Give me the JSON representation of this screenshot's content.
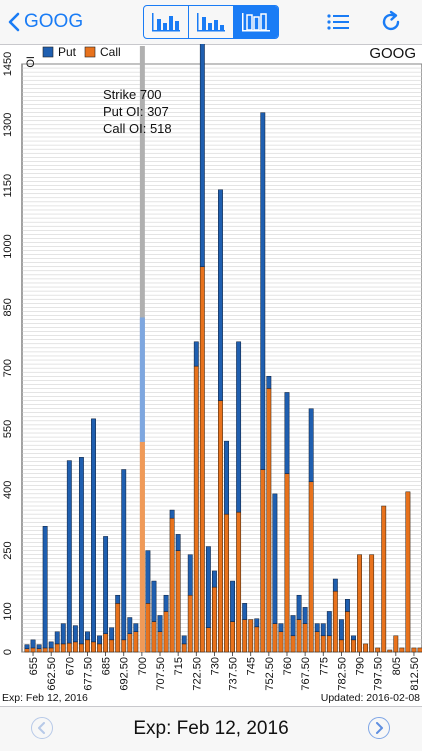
{
  "nav": {
    "back_label": "GOOG",
    "symbol": "GOOG"
  },
  "footer": {
    "exp_small": "Exp: Feb 12, 2016",
    "updated": "Updated: 2016-02-08",
    "exp_title": "Exp: Feb 12, 2016"
  },
  "colors": {
    "accent": "#1a7cf5",
    "put": "#1f5fb0",
    "call": "#e8721c",
    "highlight_put": "#7ea7e0",
    "highlight_call": "#f09a58"
  },
  "icons": {
    "back": "chevron-left-icon",
    "list": "list-icon",
    "refresh": "refresh-icon",
    "prev": "chevron-left-circle-icon",
    "next": "chevron-right-circle-icon"
  },
  "chart_data": {
    "type": "bar",
    "stacked": true,
    "ylabel": "OI",
    "ylim": [
      0,
      1450
    ],
    "yticks": [
      0,
      100,
      250,
      400,
      550,
      700,
      850,
      1000,
      1150,
      1300,
      1450
    ],
    "legend": [
      "Put",
      "Call"
    ],
    "legend_position": "top-left",
    "symbol": "GOOG",
    "highlight": {
      "strike": 700,
      "lines": [
        "Strike 700",
        "Put OI: 307",
        "Call OI: 518"
      ]
    },
    "strikes": [
      652.5,
      655,
      657.5,
      660,
      662.5,
      665,
      667.5,
      670,
      672.5,
      675,
      677.5,
      680,
      682.5,
      685,
      687.5,
      690,
      692.5,
      695,
      697.5,
      700,
      702.5,
      705,
      707.5,
      710,
      712.5,
      715,
      717.5,
      720,
      722.5,
      725,
      727.5,
      730,
      732.5,
      735,
      737.5,
      740,
      742.5,
      745,
      747.5,
      750,
      752.5,
      755,
      757.5,
      760,
      762.5,
      765,
      767.5,
      770,
      772.5,
      775,
      777.5,
      780,
      782.5,
      785,
      787.5,
      790,
      792.5,
      795,
      797.5,
      800,
      802.5,
      805,
      807.5,
      810,
      812.5,
      815
    ],
    "xtick_labels": [
      "655",
      "662.50",
      "670",
      "677.50",
      "685",
      "692.50",
      "700",
      "707.50",
      "715",
      "722.50",
      "730",
      "737.50",
      "745",
      "752.50",
      "760",
      "767.50",
      "775",
      "782.50",
      "790",
      "797.50",
      "805",
      "812.50"
    ],
    "series": [
      {
        "name": "Put",
        "values": [
          10,
          20,
          10,
          300,
          15,
          30,
          50,
          450,
          40,
          460,
          20,
          550,
          20,
          240,
          30,
          20,
          420,
          40,
          20,
          307,
          130,
          100,
          40,
          40,
          20,
          40,
          20,
          100,
          60,
          700,
          200,
          40,
          520,
          180,
          100,
          420,
          40,
          0,
          20,
          880,
          30,
          320,
          20,
          200,
          50,
          60,
          40,
          180,
          20,
          30,
          60,
          30,
          50,
          30,
          10,
          0,
          0,
          0,
          0,
          0,
          0,
          0,
          0,
          0,
          0,
          0
        ]
      },
      {
        "name": "Call",
        "values": [
          8,
          10,
          8,
          10,
          10,
          20,
          20,
          22,
          25,
          20,
          30,
          25,
          20,
          45,
          30,
          120,
          30,
          45,
          50,
          518,
          120,
          75,
          50,
          100,
          330,
          250,
          20,
          140,
          705,
          950,
          60,
          160,
          620,
          340,
          75,
          345,
          80,
          80,
          62,
          450,
          650,
          70,
          50,
          440,
          40,
          80,
          70,
          420,
          50,
          40,
          40,
          150,
          30,
          100,
          30,
          240,
          20,
          240,
          10,
          360,
          5,
          40,
          10,
          395,
          10,
          10
        ]
      }
    ]
  }
}
